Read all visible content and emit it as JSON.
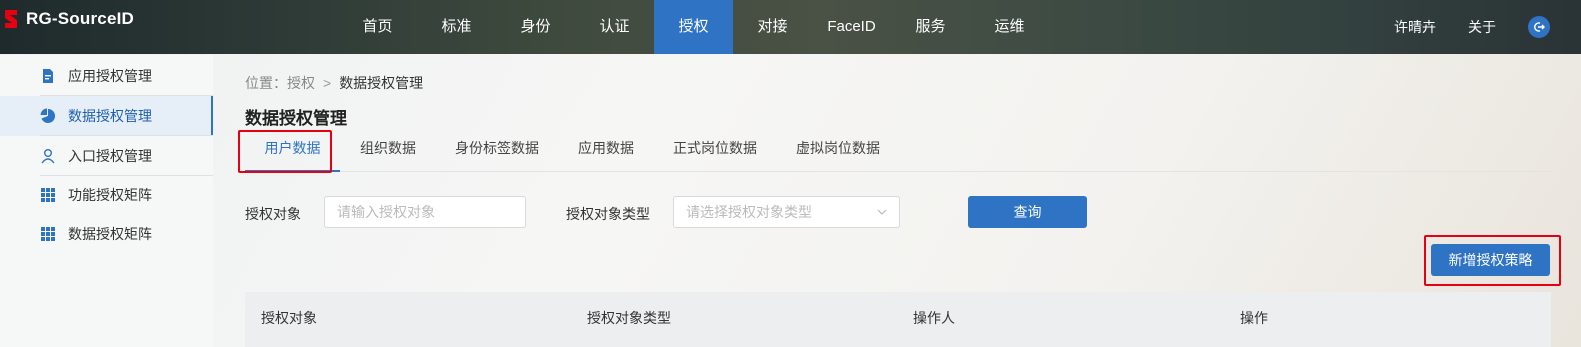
{
  "app": {
    "logo_text": "RG-SourceID"
  },
  "nav": {
    "items": [
      "首页",
      "标准",
      "身份",
      "认证",
      "授权",
      "对接",
      "FaceID",
      "服务",
      "运维"
    ],
    "active_index": 4
  },
  "header": {
    "user_name": "许晴卉",
    "about": "关于"
  },
  "sidebar": {
    "items": [
      {
        "label": "应用授权管理",
        "icon": "app-auth-icon"
      },
      {
        "label": "数据授权管理",
        "icon": "pie-chart-icon"
      },
      {
        "label": "入口授权管理",
        "icon": "user-icon"
      },
      {
        "label": "功能授权矩阵",
        "icon": "grid-icon"
      },
      {
        "label": "数据授权矩阵",
        "icon": "grid-icon"
      }
    ],
    "active_index": 1
  },
  "breadcrumb": {
    "prefix": "位置：",
    "parent": "授权",
    "separator": ">",
    "current": "数据授权管理"
  },
  "page": {
    "title": "数据授权管理"
  },
  "tabs": [
    "用户数据",
    "组织数据",
    "身份标签数据",
    "应用数据",
    "正式岗位数据",
    "虚拟岗位数据"
  ],
  "filters": {
    "object_label": "授权对象",
    "object_placeholder": "请输入授权对象",
    "type_label": "授权对象类型",
    "type_placeholder": "请选择授权对象类型",
    "query_button": "查询"
  },
  "actions": {
    "add_policy": "新增授权策略"
  },
  "table": {
    "columns": [
      "授权对象",
      "授权对象类型",
      "操作人",
      "操作"
    ]
  },
  "colors": {
    "accent": "#2f73c4",
    "highlight": "#e60012"
  }
}
